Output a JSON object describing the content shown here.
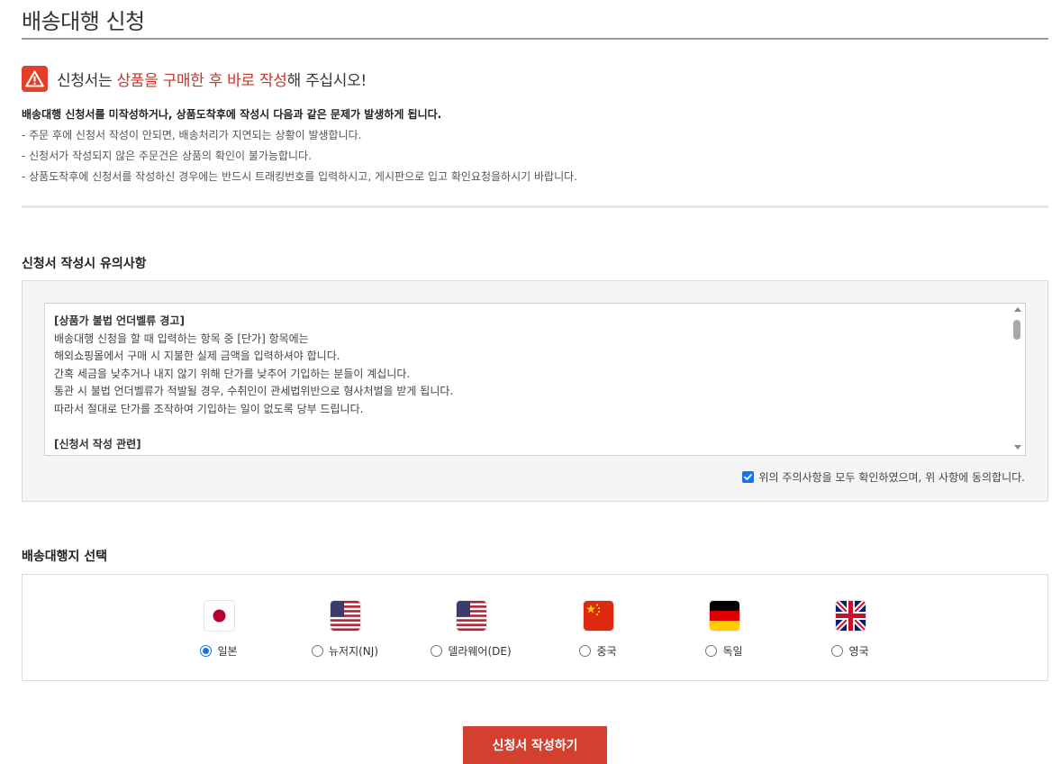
{
  "page": {
    "title": "배송대행 신청"
  },
  "warning": {
    "icon": "warning-triangle-icon",
    "prefix": "신청서는 ",
    "highlight": "상품을 구매한 후 바로 작성",
    "suffix": "해 주십시오!",
    "highlight_color": "#c8352a"
  },
  "notice": {
    "bold": "배송대행 신청서를 미작성하거나, 상품도착후에 작성시 다음과 같은 문제가 발생하게 됩니다.",
    "lines": [
      "- 주문 후에 신청서 작성이 안되면, 배송처리가 지연되는 상황이 발생합니다.",
      "- 신청서가 작성되지 않은 주문건은 상품의 확인이 불가능합니다.",
      "- 상품도착후에 신청서를 작성하신 경우에는 반드시 트래킹번호를 입력하시고, 게시판으로 입고 확인요청을하시기 바랍니다."
    ]
  },
  "terms": {
    "section_title": "신청서 작성시 유의사항",
    "heading1": "[상품가 불법 언더벨류 경고]",
    "lines": [
      "배송대행 신청을 할 때 입력하는 항목 중 [단가] 항목에는",
      "해외쇼핑몰에서 구매 시 지불한 실제 금액을 입력하셔야 합니다.",
      "간혹 세금을 낮추거나 내지 않기 위해 단가를 낮추어 기입하는 분들이 계십니다.",
      "통관 시 불법 언더벨류가 적발될 경우, 수취인이 관세법위반으로 형사처벌을 받게 됩니다.",
      "따라서 절대로 단가를 조작하여 기입하는 일이 없도록 당부 드립니다."
    ],
    "heading2": "[신청서 작성 관련]",
    "agree_label": "위의 주의사항을 모두 확인하였으며, 위 사항에 동의합니다.",
    "agree_checked": true
  },
  "destinations": {
    "section_title": "배송대행지 선택",
    "options": [
      {
        "label": "일본",
        "flag": "japan-flag-icon",
        "selected": true
      },
      {
        "label": "뉴저지(NJ)",
        "flag": "usa-flag-icon",
        "selected": false
      },
      {
        "label": "델라웨어(DE)",
        "flag": "usa-flag-icon",
        "selected": false
      },
      {
        "label": "중국",
        "flag": "china-flag-icon",
        "selected": false
      },
      {
        "label": "독일",
        "flag": "germany-flag-icon",
        "selected": false
      },
      {
        "label": "영국",
        "flag": "uk-flag-icon",
        "selected": false
      }
    ]
  },
  "submit": {
    "label": "신청서 작성하기",
    "color": "#d4402f"
  }
}
